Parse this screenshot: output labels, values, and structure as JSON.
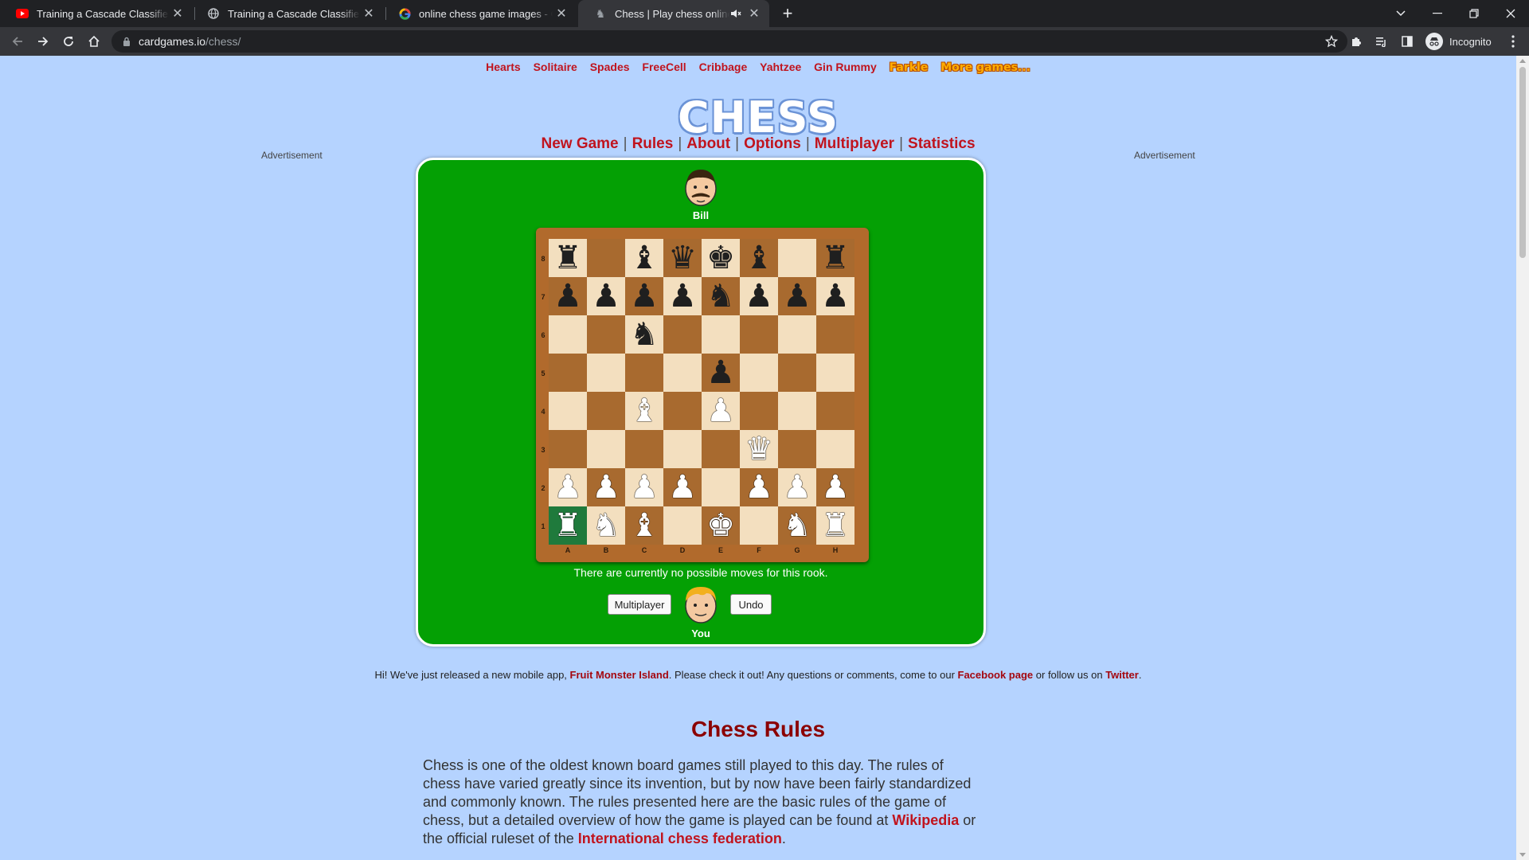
{
  "browser": {
    "tabs": [
      {
        "title": "Training a Cascade Classifier - Op",
        "icon": "youtube-icon",
        "active": false
      },
      {
        "title": "Training a Cascade Classifier - Le",
        "icon": "globe-icon",
        "active": false
      },
      {
        "title": "online chess game images - Goo",
        "icon": "google-icon",
        "active": false
      },
      {
        "title": "Chess | Play chess online, ag",
        "icon": "chess-favicon",
        "active": true
      }
    ],
    "url_host": "cardgames.io",
    "url_path": "/chess/",
    "profile_label": "Incognito"
  },
  "games_nav": {
    "links": [
      "Hearts",
      "Solitaire",
      "Spades",
      "FreeCell",
      "Cribbage",
      "Yahtzee",
      "Gin Rummy"
    ],
    "fancy_links": [
      "Farkle",
      "More games..."
    ]
  },
  "logo": "CHESS",
  "main_nav": [
    "New Game",
    "Rules",
    "About",
    "Options",
    "Multiplayer",
    "Statistics"
  ],
  "ads": {
    "left": "Advertisement",
    "right": "Advertisement"
  },
  "game": {
    "opponent_name": "Bill",
    "player_name": "You",
    "status": "There are currently no possible moves for this rook.",
    "buttons": {
      "multiplayer": "Multiplayer",
      "undo": "Undo"
    },
    "ranks": [
      "8",
      "7",
      "6",
      "5",
      "4",
      "3",
      "2",
      "1"
    ],
    "files": [
      "A",
      "B",
      "C",
      "D",
      "E",
      "F",
      "G",
      "H"
    ],
    "board": [
      [
        "br",
        "",
        "bb",
        "bq",
        "bk",
        "bb",
        "",
        "br"
      ],
      [
        "bp",
        "bp",
        "bp",
        "bp",
        "bn",
        "bp",
        "bp",
        "bp"
      ],
      [
        "",
        "",
        "bn",
        "",
        "",
        "",
        "",
        ""
      ],
      [
        "",
        "",
        "",
        "",
        "bp",
        "",
        "",
        ""
      ],
      [
        "",
        "",
        "wb",
        "",
        "wp",
        "",
        "",
        ""
      ],
      [
        "",
        "",
        "",
        "",
        "",
        "wq",
        "",
        ""
      ],
      [
        "wp",
        "wp",
        "wp",
        "wp",
        "",
        "wp",
        "wp",
        "wp"
      ],
      [
        "wr",
        "wn",
        "wb",
        "",
        "wk",
        "",
        "wn",
        "wr"
      ]
    ],
    "highlighted_square": "A1",
    "colors": {
      "table_green": "#04a004",
      "light_square": "#f3dfbf",
      "dark_square": "#a86a2f",
      "highlight": "#1f7a3c"
    }
  },
  "notice": {
    "t1": "Hi! We've just released a new mobile app, ",
    "link1": "Fruit Monster Island",
    "t2": ". Please check it out! Any questions or comments, come to our ",
    "link2": "Facebook page",
    "t3": " or follow us on ",
    "link3": "Twitter",
    "t4": "."
  },
  "rules": {
    "title": "Chess Rules",
    "p1": "Chess is one of the oldest known board games still played to this day. The rules of chess have varied greatly since its invention, but by now have been fairly standardized and commonly known. The rules presented here are the basic rules of the game of chess, but a detailed overview of how the game is played can be found at ",
    "link1": "Wikipedia",
    "p2": " or the official ruleset of the ",
    "link2": "International chess federation",
    "p3": "."
  }
}
